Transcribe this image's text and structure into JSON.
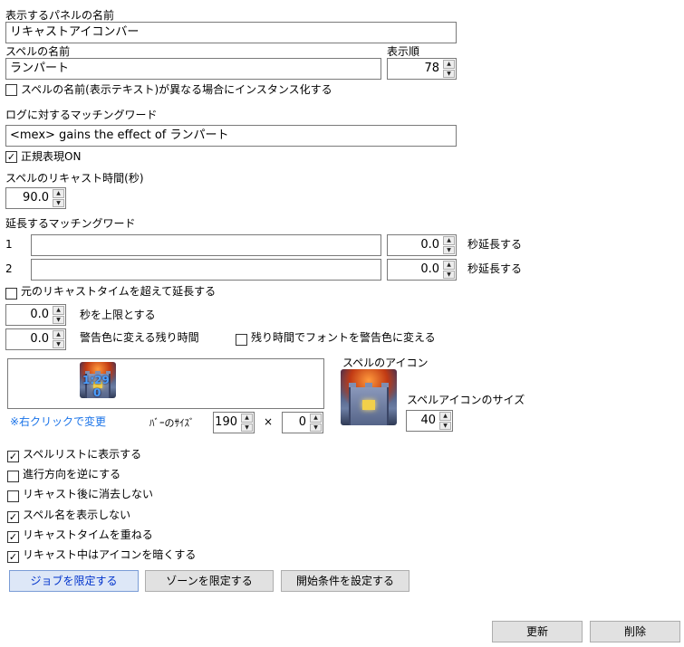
{
  "panel_name": {
    "label": "表示するパネルの名前",
    "value": "リキャストアイコンバー"
  },
  "spell_name": {
    "label": "スペルの名前",
    "value": "ランパート"
  },
  "display_order": {
    "label": "表示順",
    "value": "78"
  },
  "instance_checkbox": {
    "label": "スペルの名前(表示テキスト)が異なる場合にインスタンス化する",
    "checked": false
  },
  "log_match": {
    "label": "ログに対するマッチングワード",
    "value": "<mex> gains the effect of ランパート"
  },
  "regex_checkbox": {
    "label": "正規表現ON",
    "checked": true
  },
  "recast_time": {
    "label": "スペルのリキャスト時間(秒)",
    "value": "90.0"
  },
  "extend": {
    "label": "延長するマッチングワード",
    "rows": [
      {
        "index": "1",
        "word": "",
        "seconds": "0.0",
        "suffix": "秒延長する"
      },
      {
        "index": "2",
        "word": "",
        "seconds": "0.0",
        "suffix": "秒延長する"
      }
    ]
  },
  "over_recast_checkbox": {
    "label": "元のリキャストタイムを超えて延長する",
    "checked": false
  },
  "upper_limit": {
    "value": "0.0",
    "suffix": "秒を上限とする"
  },
  "warning_time": {
    "value": "0.0",
    "suffix": "警告色に変える残り時間"
  },
  "warning_font_checkbox": {
    "label": "残り時間でフォントを警告色に変える",
    "checked": false
  },
  "preview": {
    "overlay_text": "1:29",
    "overlay_sub": "0",
    "right_click_hint": "※右クリックで変更"
  },
  "bar_size": {
    "label": "ﾊﾞｰのｻｲｽﾞ",
    "width": "190",
    "times": "×",
    "height": "0"
  },
  "spell_icon": {
    "label": "スペルのアイコン",
    "size_label": "スペルアイコンのサイズ",
    "size": "40"
  },
  "options": [
    {
      "label": "スペルリストに表示する",
      "checked": true
    },
    {
      "label": "進行方向を逆にする",
      "checked": false
    },
    {
      "label": "リキャスト後に消去しない",
      "checked": false
    },
    {
      "label": "スペル名を表示しない",
      "checked": true
    },
    {
      "label": "リキャストタイムを重ねる",
      "checked": true
    },
    {
      "label": "リキャスト中はアイコンを暗くする",
      "checked": true
    }
  ],
  "buttons": {
    "job_limit": "ジョブを限定する",
    "zone_limit": "ゾーンを限定する",
    "start_condition": "開始条件を設定する",
    "update": "更新",
    "delete": "削除"
  },
  "colors": {
    "link": "#1a73e8",
    "primary_button_text": "#0033cc"
  }
}
